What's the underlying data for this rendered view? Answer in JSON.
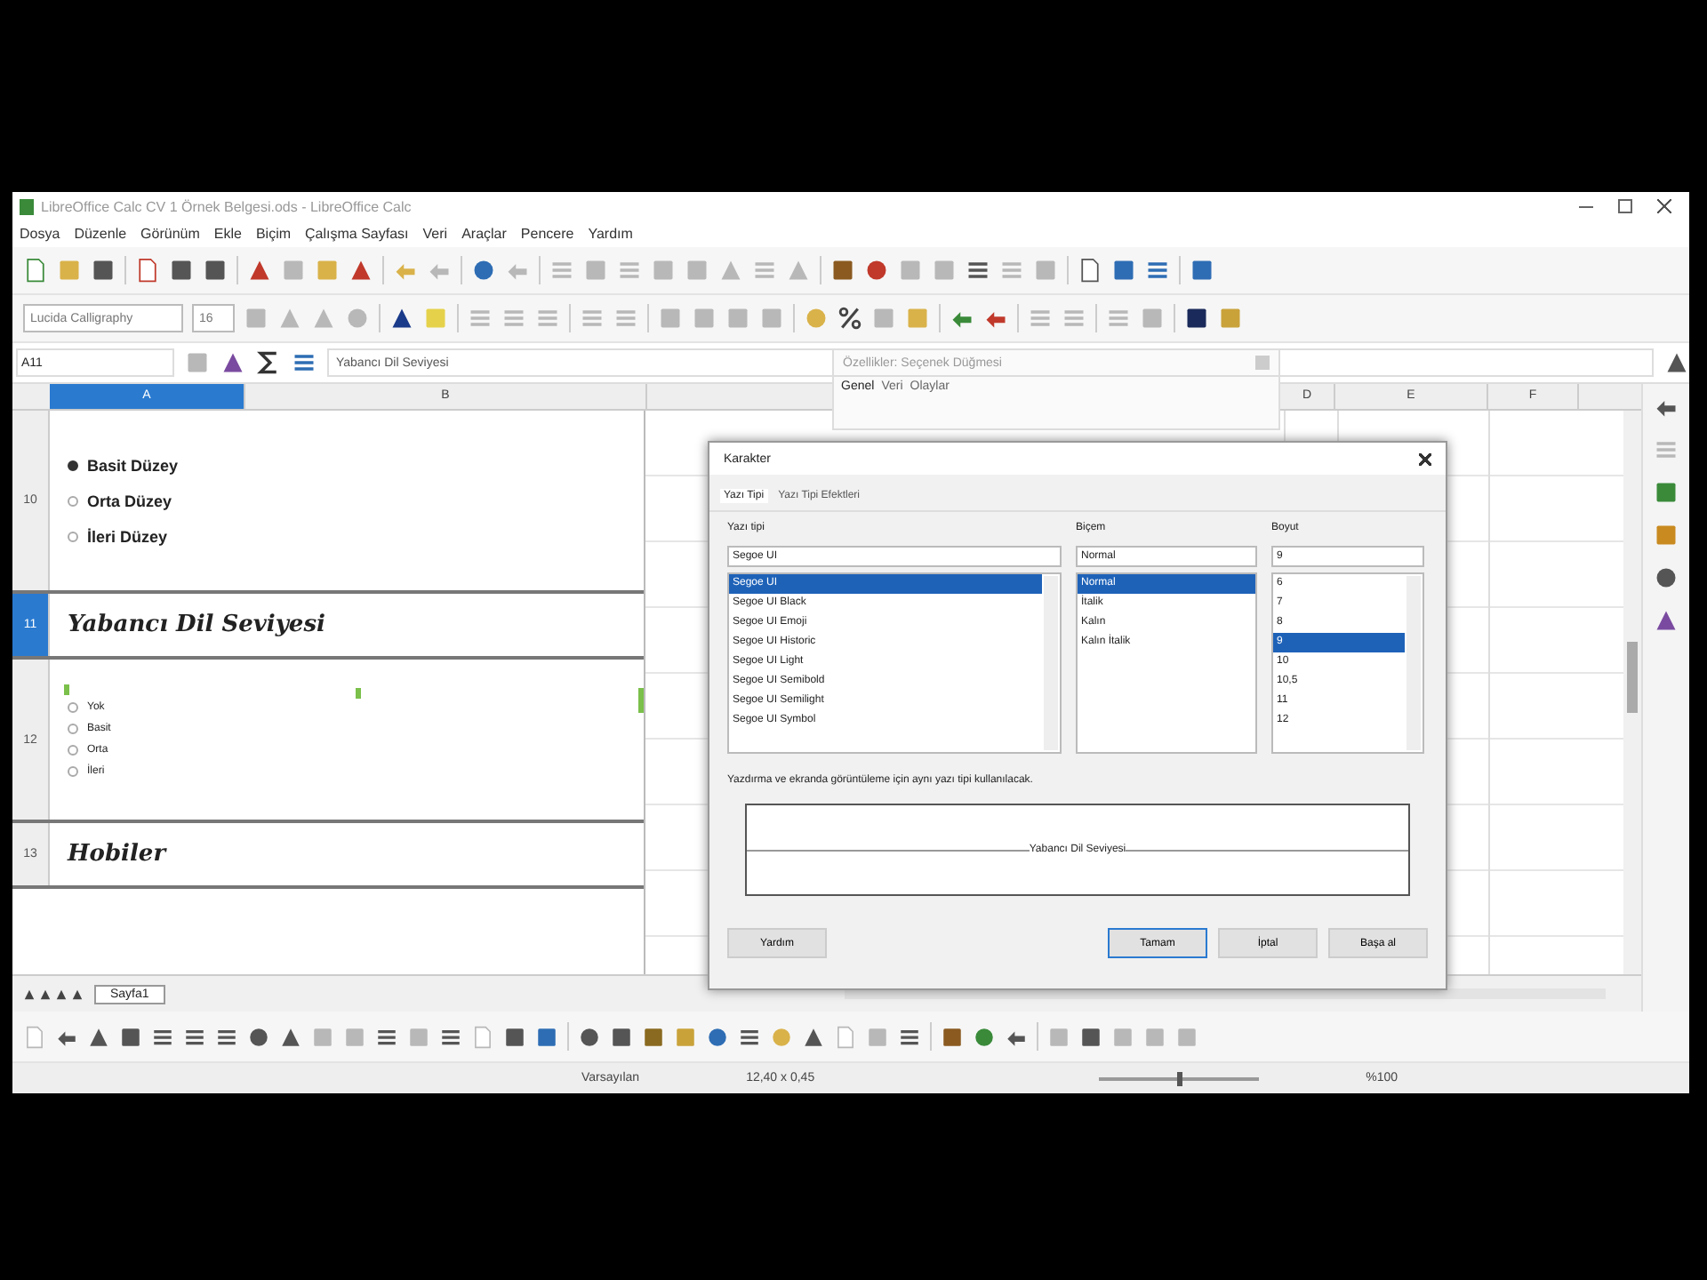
{
  "window": {
    "title": "LibreOffice Calc CV 1 Örnek Belgesi.ods - LibreOffice Calc"
  },
  "menu": [
    "Dosya",
    "Düzenle",
    "Görünüm",
    "Ekle",
    "Biçim",
    "Çalışma Sayfası",
    "Veri",
    "Araçlar",
    "Pencere",
    "Yardım"
  ],
  "format_bar": {
    "font_name": "Lucida Calligraphy",
    "font_size": "16"
  },
  "formula_bar": {
    "name_box": "A11",
    "formula": "Yabancı Dil Seviyesi"
  },
  "properties_panel": {
    "title": "Özellikler: Seçenek Düğmesi",
    "tabs": [
      {
        "label": "Genel",
        "selected": true
      },
      {
        "label": "Veri",
        "selected": false
      },
      {
        "label": "Olaylar",
        "selected": false
      }
    ]
  },
  "sheet": {
    "columns": [
      {
        "label": "A",
        "selected": true
      },
      {
        "label": "B",
        "selected": false
      }
    ],
    "right_columns": [
      "D",
      "E",
      "F"
    ],
    "rows": [
      {
        "header": "10",
        "selected": false,
        "kind": "options",
        "items": [
          {
            "label": "Basit Düzey",
            "selected": true
          },
          {
            "label": "Orta Düzey",
            "selected": false
          },
          {
            "label": "İleri Düzey",
            "selected": false
          }
        ]
      },
      {
        "header": "11",
        "selected": true,
        "kind": "heading",
        "text": "Yabancı Dil Seviyesi"
      },
      {
        "header": "12",
        "selected": false,
        "kind": "small-options",
        "items": [
          {
            "label": "Yok",
            "selected": false
          },
          {
            "label": "Basit",
            "selected": false
          },
          {
            "label": "Orta",
            "selected": false
          },
          {
            "label": "İleri",
            "selected": false
          }
        ]
      },
      {
        "header": "13",
        "selected": false,
        "kind": "heading",
        "text": "Hobiler"
      }
    ]
  },
  "sheet_tabs": [
    {
      "label": "Sayfa1",
      "selected": true
    }
  ],
  "dialog": {
    "title": "Karakter",
    "tabs": [
      {
        "label": "Yazı Tipi",
        "selected": true
      },
      {
        "label": "Yazı Tipi Efektleri",
        "selected": false
      }
    ],
    "family": {
      "label": "Yazı tipi",
      "value": "Segoe UI",
      "options": [
        {
          "label": "Segoe UI",
          "selected": true
        },
        {
          "label": "Segoe UI Black",
          "selected": false
        },
        {
          "label": "Segoe UI Emoji",
          "selected": false
        },
        {
          "label": "Segoe UI Historic",
          "selected": false
        },
        {
          "label": "Segoe UI Light",
          "selected": false
        },
        {
          "label": "Segoe UI Semibold",
          "selected": false
        },
        {
          "label": "Segoe UI Semilight",
          "selected": false
        },
        {
          "label": "Segoe UI Symbol",
          "selected": false
        }
      ]
    },
    "style": {
      "label": "Biçem",
      "value": "Normal",
      "options": [
        {
          "label": "Normal",
          "selected": true
        },
        {
          "label": "İtalik",
          "selected": false
        },
        {
          "label": "Kalın",
          "selected": false
        },
        {
          "label": "Kalın İtalik",
          "selected": false
        }
      ]
    },
    "size": {
      "label": "Boyut",
      "value": "9",
      "options": [
        {
          "label": "6",
          "selected": false
        },
        {
          "label": "7",
          "selected": false
        },
        {
          "label": "8",
          "selected": false
        },
        {
          "label": "9",
          "selected": true
        },
        {
          "label": "10",
          "selected": false
        },
        {
          "label": "10,5",
          "selected": false
        },
        {
          "label": "11",
          "selected": false
        },
        {
          "label": "12",
          "selected": false
        }
      ]
    },
    "note": "Yazdırma ve ekranda görüntüleme için aynı yazı tipi kullanılacak.",
    "preview": "Yabancı Dil Seviyesi",
    "buttons": [
      {
        "label": "Yardım",
        "default": false
      },
      {
        "label": "Tamam",
        "default": true
      },
      {
        "label": "İptal",
        "default": false
      },
      {
        "label": "Başa al",
        "default": false
      }
    ]
  },
  "status_bar": {
    "items": [
      "Varsayılan",
      "12,40 x 0,45"
    ],
    "zoom": {
      "level": 0.5,
      "reading": "%100"
    }
  }
}
